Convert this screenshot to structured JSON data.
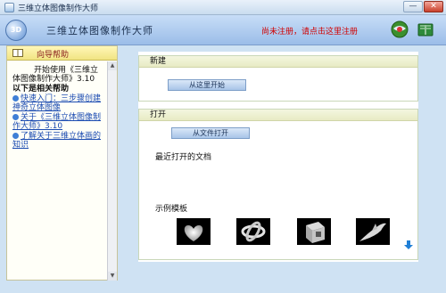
{
  "window": {
    "title": "三维立体图像制作大师",
    "minimize_glyph": "—",
    "close_glyph": "✕"
  },
  "header": {
    "logo_text": "3D",
    "app_title": "三维立体图像制作大师",
    "register_link": "尚未注册，请点击这里注册"
  },
  "sidebar": {
    "heading": "向导帮助",
    "welcome": "开始使用《三维立体图像制作大师》3.10",
    "section_title": "以下是相关帮助",
    "links": [
      "快速入门：三步骤创建神奇立体图像",
      "关于《三维立体图像制作大师》3.10",
      "了解关于三维立体画的知识"
    ]
  },
  "main": {
    "new_panel": {
      "heading": "新建",
      "button": "从这里开始"
    },
    "open_panel": {
      "heading": "打开",
      "button": "从文件打开",
      "recent_label": "最近打开的文档",
      "templates_label": "示例模板",
      "templates": [
        "heart-template",
        "knot-template",
        "cube-template",
        "dolphin-template"
      ]
    }
  },
  "colors": {
    "register_text": "#d10000",
    "link_text": "#1b4bb1",
    "header_bg": "#9bbde8",
    "panel_head_bg": "#e8ebc4"
  }
}
